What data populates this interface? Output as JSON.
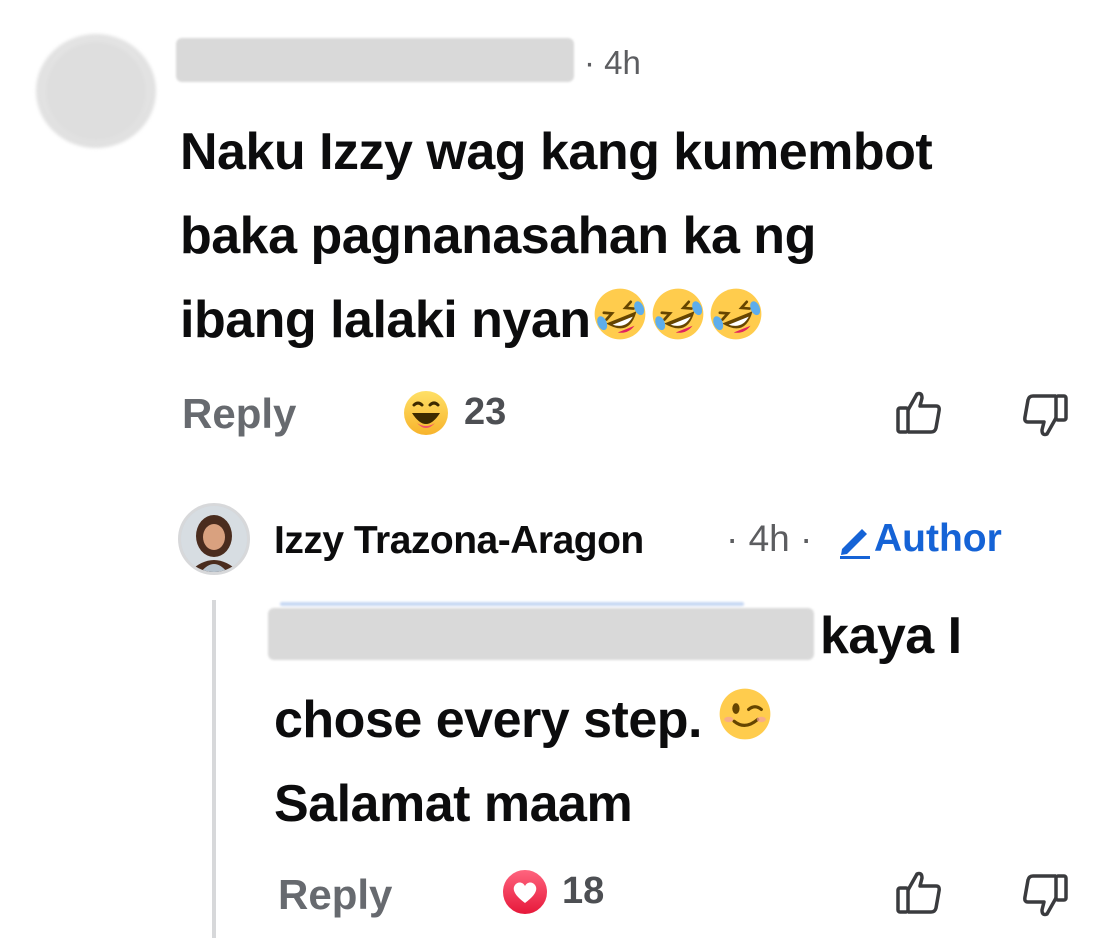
{
  "comment": {
    "author_name": "",
    "timestamp": "· 4h",
    "text_lines": [
      "Naku Izzy wag kang kumembot",
      "baka pagnanasahan ka ng",
      "ibang lalaki nyan"
    ],
    "trailing_emojis": [
      "rolling-on-floor-laughing",
      "rolling-on-floor-laughing",
      "rolling-on-floor-laughing"
    ],
    "reply_label": "Reply",
    "reaction": {
      "icon": "haha-reaction",
      "count": "23"
    },
    "actions": [
      "like-icon",
      "dislike-icon"
    ]
  },
  "reply": {
    "author_name": "Izzy Trazona-Aragon",
    "timestamp": "· 4h ·",
    "badge": "Author",
    "tag_name": "",
    "text_line_1_tail": "kaya I",
    "text_line_2": "chose every step.",
    "text_line_2_emoji": "winking-face",
    "text_line_3": "Salamat maam",
    "reply_label": "Reply",
    "reaction": {
      "icon": "love-reaction",
      "count": "18"
    },
    "actions": [
      "like-icon",
      "dislike-icon"
    ]
  },
  "colors": {
    "link_gray": "#676a6f",
    "author_blue": "#1563d6",
    "love_red": "#f33e58"
  }
}
